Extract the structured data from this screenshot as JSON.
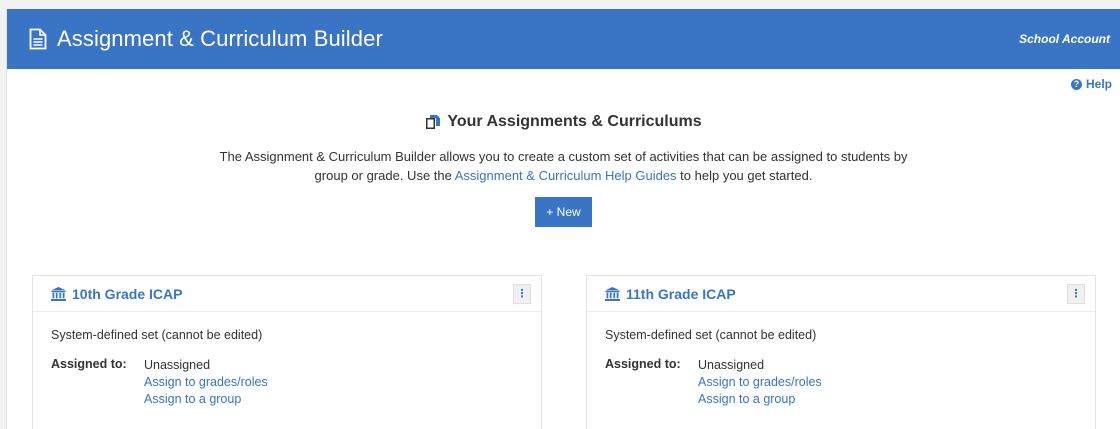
{
  "header": {
    "title": "Assignment & Curriculum Builder",
    "account": "School Account",
    "title_icon": "document-icon"
  },
  "help": {
    "label": "Help",
    "icon": "question-circle-icon"
  },
  "intro": {
    "heading": "Your Assignments & Curriculums",
    "text_before": "The Assignment & Curriculum Builder allows you to create a custom set of activities that can be assigned to students by group or grade. Use the ",
    "link": "Assignment & Curriculum Help Guides",
    "text_after": " to help you get started.",
    "new_button": "+ New"
  },
  "cards": [
    {
      "title": "10th Grade ICAP",
      "note": "System-defined set (cannot be edited)",
      "assigned_label": "Assigned to:",
      "assigned_value": "Unassigned",
      "link_grades": "Assign to grades/roles",
      "link_group": "Assign to a group"
    },
    {
      "title": "11th Grade ICAP",
      "note": "System-defined set (cannot be edited)",
      "assigned_label": "Assigned to:",
      "assigned_value": "Unassigned",
      "link_grades": "Assign to grades/roles",
      "link_group": "Assign to a group"
    }
  ],
  "colors": {
    "brand": "#3a74c4",
    "text": "#333333"
  }
}
